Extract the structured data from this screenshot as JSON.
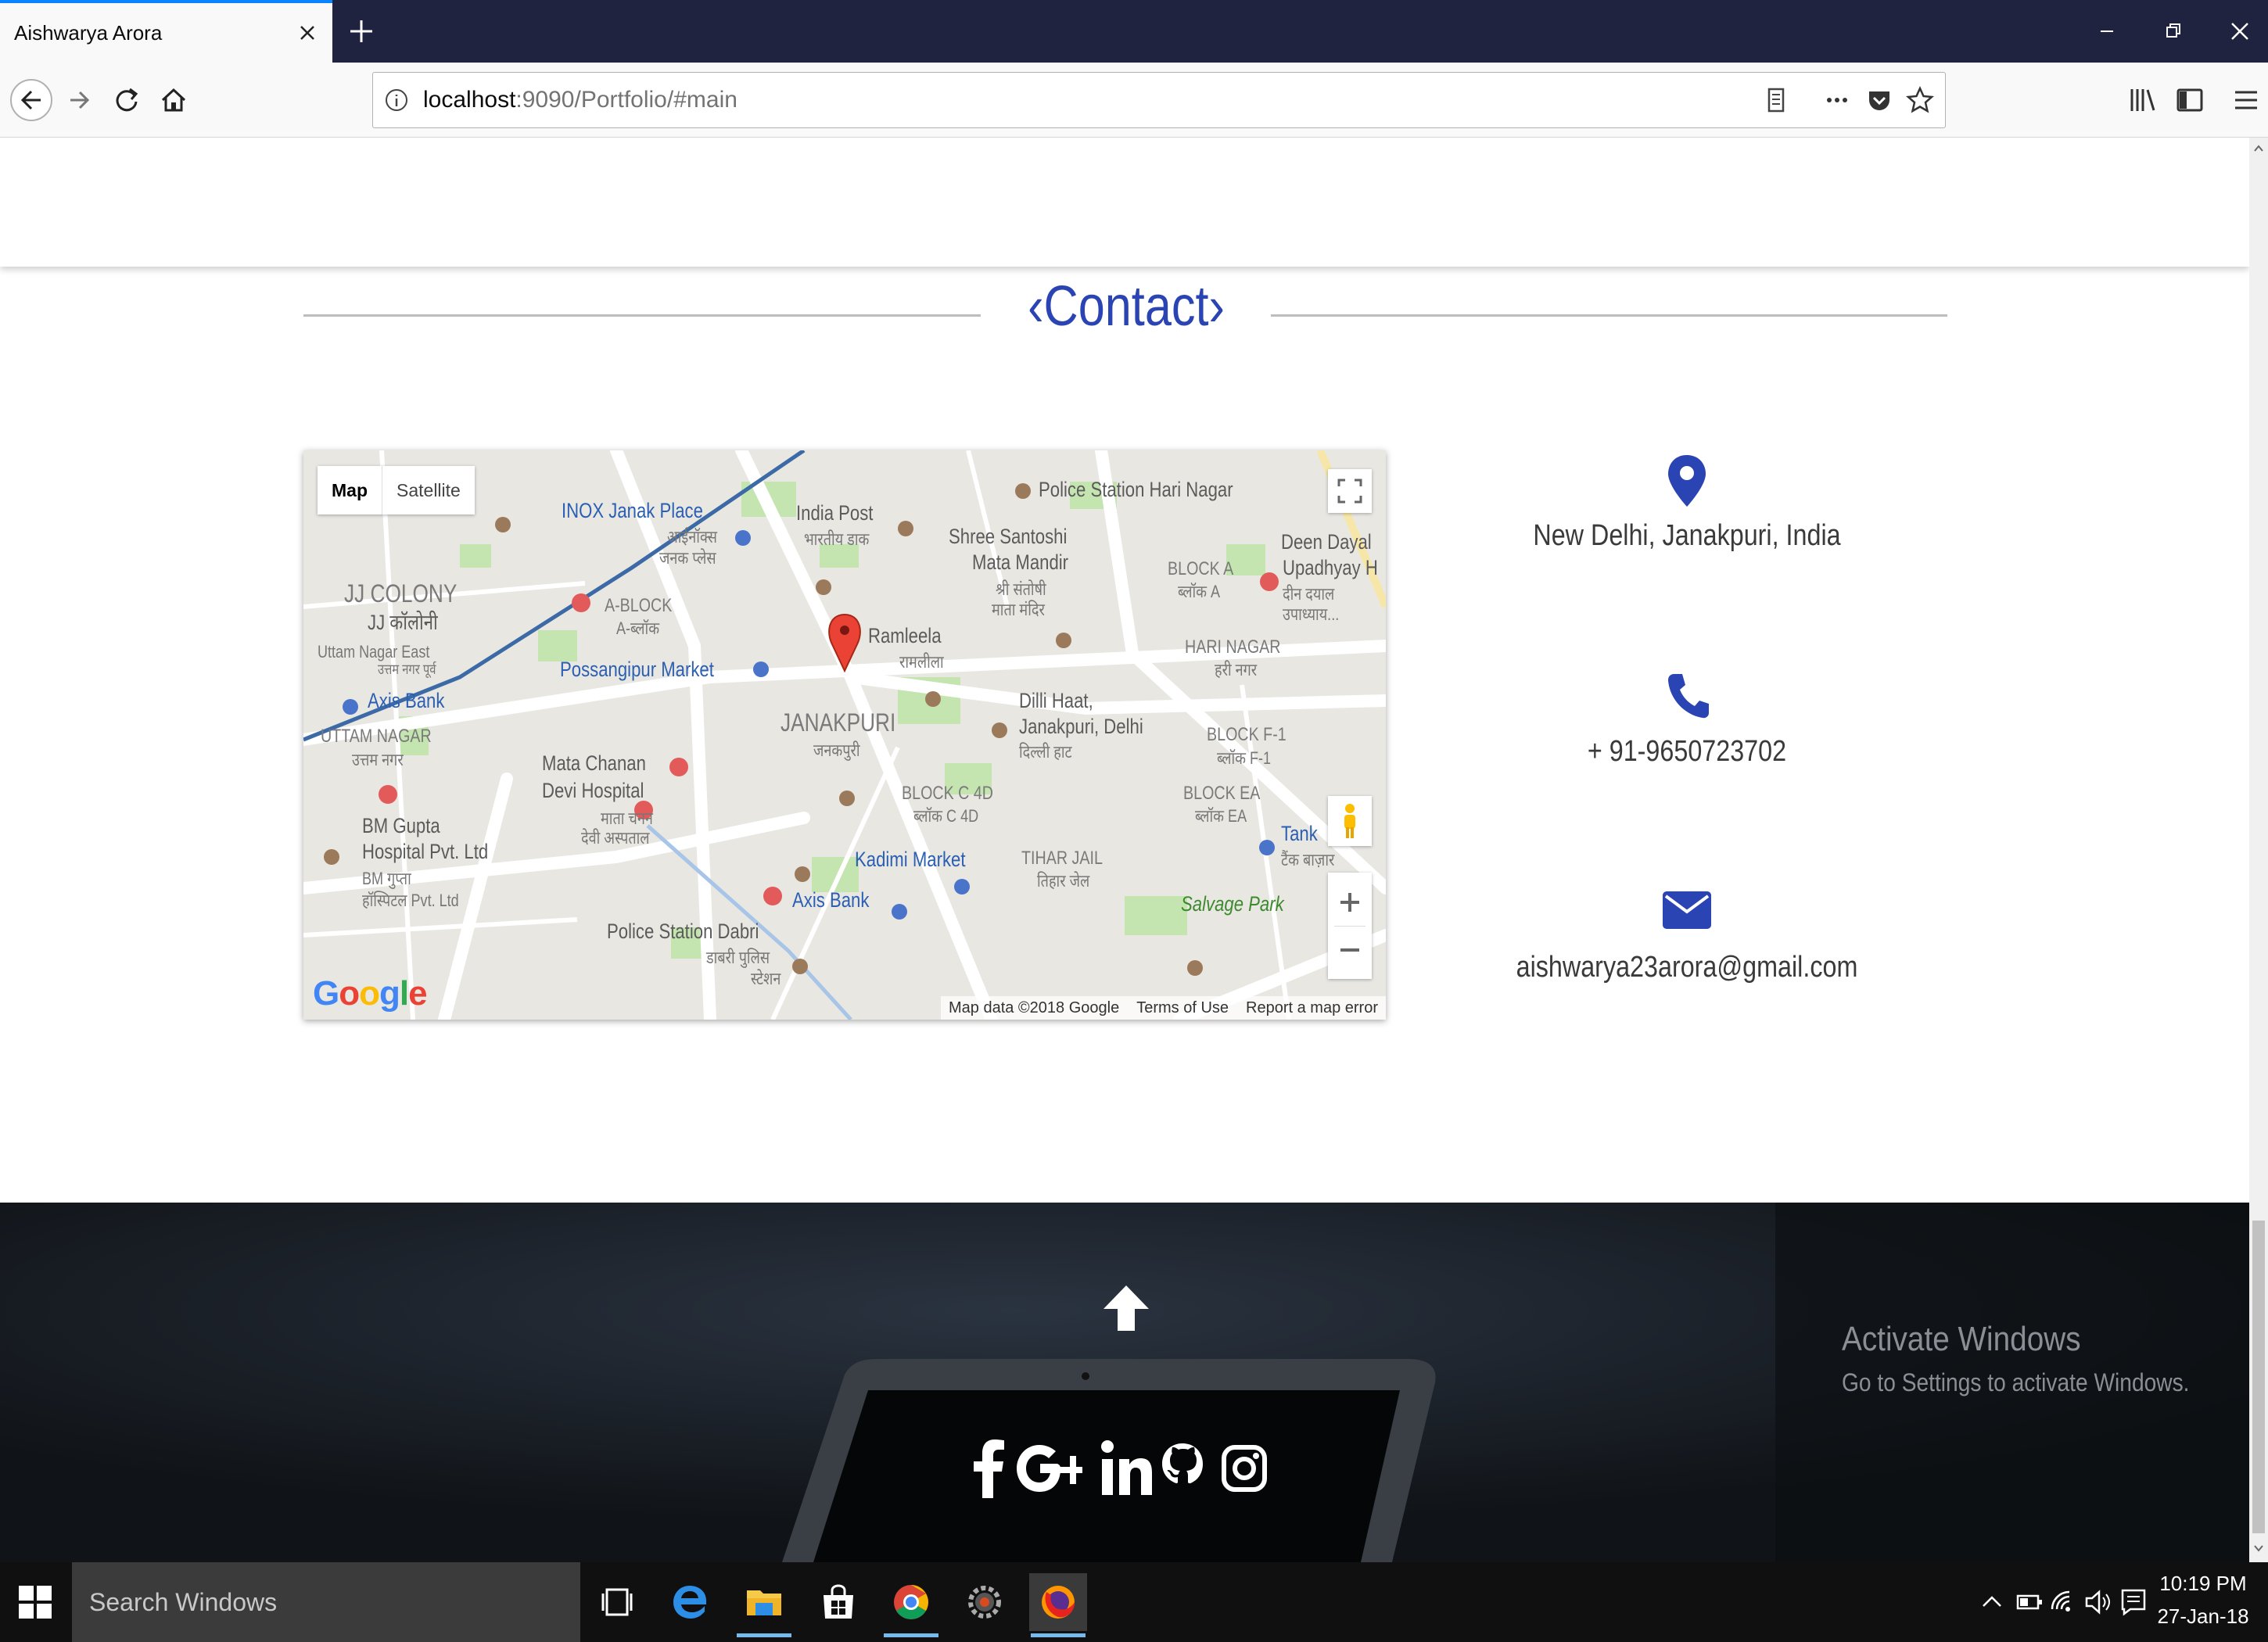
{
  "browser": {
    "tab_title": "Aishwarya Arora",
    "url_host": "localhost",
    "url_rest": ":9090/Portfolio/#main"
  },
  "page": {
    "section_title": "‹Contact›",
    "map": {
      "map_button": "Map",
      "satellite_button": "Satellite",
      "footer_data": "Map data ©2018 Google",
      "footer_terms": "Terms of Use",
      "footer_report": "Report a map error",
      "logo": "Google",
      "labels": [
        "INOX Janak Place",
        "आईनॉक्स",
        "जनक प्लेस",
        "India Post",
        "भारतीय डाक",
        "Police Station Hari Nagar",
        "Shree Santoshi",
        "Mata Mandir",
        "श्री संतोषी",
        "माता मंदिर",
        "BLOCK A",
        "ब्लॉक A",
        "Deen Dayal",
        "Upadhyay H",
        "दीन दयाल",
        "उपाध्याय...",
        "JJ COLONY",
        "JJ कॉलोनी",
        "A-BLOCK",
        "A-ब्लॉक",
        "Uttam Nagar East",
        "उत्तम नगर पूर्व",
        "Ramleela",
        "रामलीला",
        "HARI NAGAR",
        "हरी नगर",
        "Possangipur Market",
        "Axis Bank",
        "JANAKPURI",
        "जनकपुरी",
        "Dilli Haat,",
        "Janakpuri, Delhi",
        "दिल्ली हाट",
        "UTTAM NAGAR",
        "उत्तम नगर",
        "BLOCK F-1",
        "ब्लॉक F-1",
        "Mata Chanan",
        "Devi Hospital",
        "माता चनन",
        "देवी अस्पताल",
        "BLOCK C 4D",
        "ब्लॉक C 4D",
        "BLOCK EA",
        "ब्लॉक EA",
        "BM Gupta",
        "Hospital Pvt. Ltd",
        "BM गुप्ता",
        "हॉस्पिटल Pvt. Ltd",
        "Kadimi Market",
        "TIHAR JAIL",
        "तिहार जेल",
        "Tank",
        "टैंक बाज़ार",
        "Axis Bank",
        "Salvage Park",
        "Police Station Dabri",
        "डाबरी पुलिस",
        "स्टेशन"
      ]
    },
    "contact": {
      "address": "New Delhi, Janakpuri, India",
      "phone": "+ 91-9650723702",
      "email": "aishwarya23arora@gmail.com"
    },
    "footer": {
      "social": [
        "facebook",
        "google-plus",
        "linkedin",
        "github",
        "instagram"
      ]
    },
    "watermark": {
      "title": "Activate Windows",
      "subtitle": "Go to Settings to activate Windows."
    }
  },
  "taskbar": {
    "search_placeholder": "Search Windows",
    "time": "10:19 PM",
    "date": "27-Jan-18"
  },
  "colors": {
    "accent": "#2b44b3",
    "titlebar": "#202340",
    "footer": "#15191f"
  }
}
